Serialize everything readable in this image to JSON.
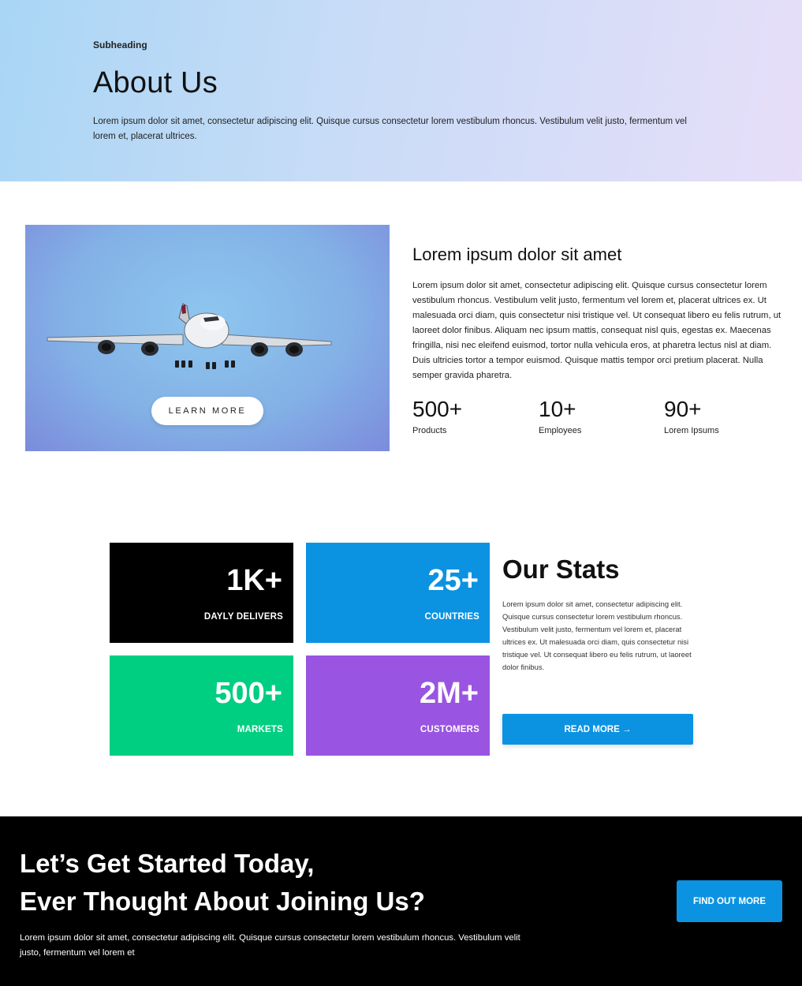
{
  "hero": {
    "subheading": "Subheading",
    "title": "About Us",
    "text": "Lorem ipsum dolor sit amet, consectetur adipiscing elit. Quisque cursus consectetur lorem vestibulum rhoncus. Vestibulum velit justo, fermentum vel lorem et, placerat ultrices."
  },
  "about": {
    "image_icon": "airplane-photo",
    "button_label": "LEARN MORE",
    "heading": "Lorem ipsum dolor sit amet",
    "text": "Lorem ipsum dolor sit amet, consectetur adipiscing elit. Quisque cursus consectetur lorem vestibulum rhoncus. Vestibulum velit justo, fermentum vel lorem et, placerat ultrices ex. Ut malesuada orci diam, quis consectetur nisi tristique vel. Ut consequat libero eu felis rutrum, ut laoreet dolor finibus. Aliquam nec ipsum mattis, consequat nisl quis, egestas ex. Maecenas fringilla, nisi nec eleifend euismod, tortor nulla vehicula eros, at pharetra lectus nisl at diam. Duis ultricies tortor a tempor euismod. Quisque mattis tempor orci pretium placerat. Nulla semper gravida pharetra.",
    "stats": [
      {
        "value": "500+",
        "label": "Products"
      },
      {
        "value": "10+",
        "label": "Employees"
      },
      {
        "value": "90+",
        "label": "Lorem Ipsums"
      }
    ]
  },
  "stats": {
    "boxes": [
      {
        "value": "1K+",
        "label": "DAYLY DELIVERS",
        "color": "#000000"
      },
      {
        "value": "25+",
        "label": "COUNTRIES",
        "color": "#0b93e2"
      },
      {
        "value": "500+",
        "label": "MARKETS",
        "color": "#00cf82"
      },
      {
        "value": "2M+",
        "label": "CUSTOMERS",
        "color": "#9a54e2"
      }
    ],
    "heading": "Our Stats",
    "text": "Lorem ipsum dolor sit amet, consectetur adipiscing elit. Quisque cursus consectetur lorem vestibulum rhoncus. Vestibulum velit justo, fermentum vel lorem et, placerat ultrices ex. Ut malesuada orci diam, quis consectetur nisi tristique vel. Ut consequat libero eu felis rutrum, ut laoreet dolor finibus.",
    "button_label": "READ MORE →"
  },
  "cta": {
    "title_line1": "Let’s Get Started Today,",
    "title_line2": "Ever Thought About Joining Us?",
    "text": "Lorem ipsum dolor sit amet, consectetur adipiscing elit. Quisque cursus consectetur lorem vestibulum rhoncus. Vestibulum velit justo, fermentum vel lorem et",
    "button_label": "FIND OUT MORE"
  },
  "colors": {
    "accent_blue": "#0b93e2",
    "green": "#00cf82",
    "purple": "#9a54e2",
    "black": "#000000"
  }
}
